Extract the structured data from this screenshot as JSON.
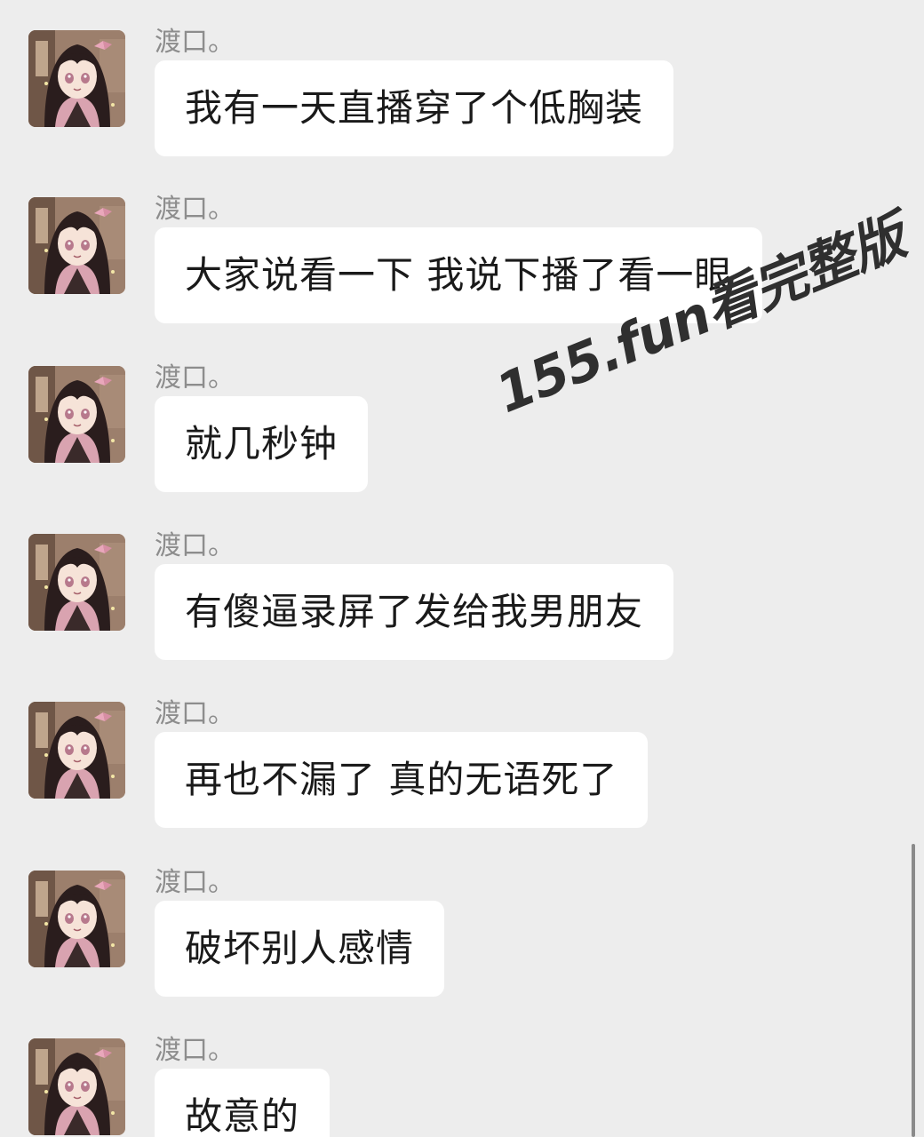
{
  "messages": [
    {
      "sender": "渡口。",
      "text": "我有一天直播穿了个低胸装"
    },
    {
      "sender": "渡口。",
      "text": "大家说看一下 我说下播了看一眼"
    },
    {
      "sender": "渡口。",
      "text": "就几秒钟"
    },
    {
      "sender": "渡口。",
      "text": "有傻逼录屏了发给我男朋友"
    },
    {
      "sender": "渡口。",
      "text": "再也不漏了  真的无语死了"
    },
    {
      "sender": "渡口。",
      "text": "破坏别人感情"
    },
    {
      "sender": "渡口。",
      "text": "故意的"
    }
  ],
  "watermark": "155.fun看完整版",
  "avatar_icon": "anime-girl-avatar-icon",
  "colors": {
    "background": "#ededed",
    "bubble": "#ffffff",
    "sender_text": "#8d8d8d",
    "message_text": "#1a1a1a"
  }
}
